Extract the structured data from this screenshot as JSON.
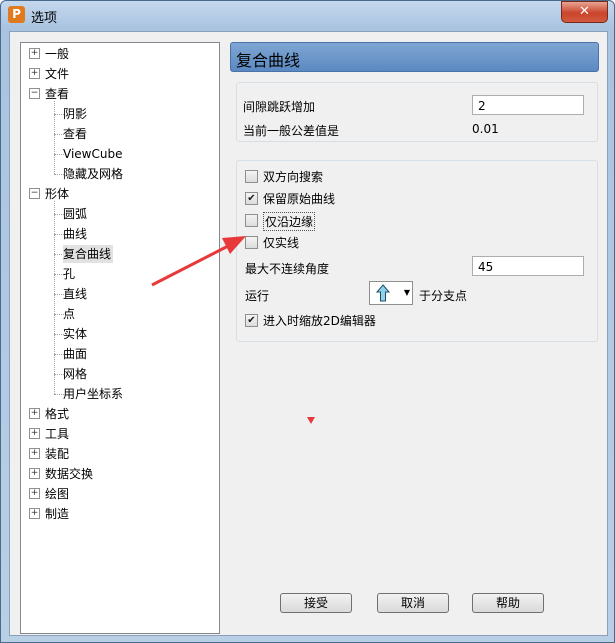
{
  "window": {
    "title": "选项",
    "close_glyph": "✕",
    "app_icon_letter": "P"
  },
  "tree": {
    "items": [
      {
        "label": "一般",
        "level": 0,
        "expander": "+"
      },
      {
        "label": "文件",
        "level": 0,
        "expander": "+"
      },
      {
        "label": "查看",
        "level": 0,
        "expander": "−"
      },
      {
        "label": "阴影",
        "level": 1
      },
      {
        "label": "查看",
        "level": 1
      },
      {
        "label": "ViewCube",
        "level": 1
      },
      {
        "label": "隐藏及网格",
        "level": 1
      },
      {
        "label": "形体",
        "level": 0,
        "expander": "−"
      },
      {
        "label": "圆弧",
        "level": 1
      },
      {
        "label": "曲线",
        "level": 1
      },
      {
        "label": "复合曲线",
        "level": 1,
        "selected": true
      },
      {
        "label": "孔",
        "level": 1
      },
      {
        "label": "直线",
        "level": 1
      },
      {
        "label": "点",
        "level": 1
      },
      {
        "label": "实体",
        "level": 1
      },
      {
        "label": "曲面",
        "level": 1
      },
      {
        "label": "网格",
        "level": 1
      },
      {
        "label": "用户坐标系",
        "level": 1
      },
      {
        "label": "格式",
        "level": 0,
        "expander": "+"
      },
      {
        "label": "工具",
        "level": 0,
        "expander": "+"
      },
      {
        "label": "装配",
        "level": 0,
        "expander": "+"
      },
      {
        "label": "数据交换",
        "level": 0,
        "expander": "+"
      },
      {
        "label": "绘图",
        "level": 0,
        "expander": "+"
      },
      {
        "label": "制造",
        "level": 0,
        "expander": "+"
      }
    ]
  },
  "panel": {
    "title": "复合曲线",
    "gap_label": "间隙跳跃增加",
    "gap_value": "2",
    "tolerance_label": "当前一般公差值是",
    "tolerance_value": "0.01",
    "checkboxes": [
      {
        "label": "双方向搜索",
        "checked": false
      },
      {
        "label": "保留原始曲线",
        "checked": true
      },
      {
        "label": "仅沿边缘",
        "checked": false
      },
      {
        "label": "仅实线",
        "checked": false
      }
    ],
    "max_angle_label": "最大不连续角度",
    "max_angle_value": "45",
    "run_label": "运行",
    "run_suffix": "于分支点",
    "run_icon": "up-arrow-icon",
    "zoom2d_label": "进入时缩放2D编辑器",
    "zoom2d_checked": true
  },
  "buttons": {
    "accept": "接受",
    "cancel": "取消",
    "help": "帮助"
  },
  "colors": {
    "header": "#5b89c2",
    "annotation_arrow": "#e8393a",
    "selection": "#e2e2e2"
  }
}
